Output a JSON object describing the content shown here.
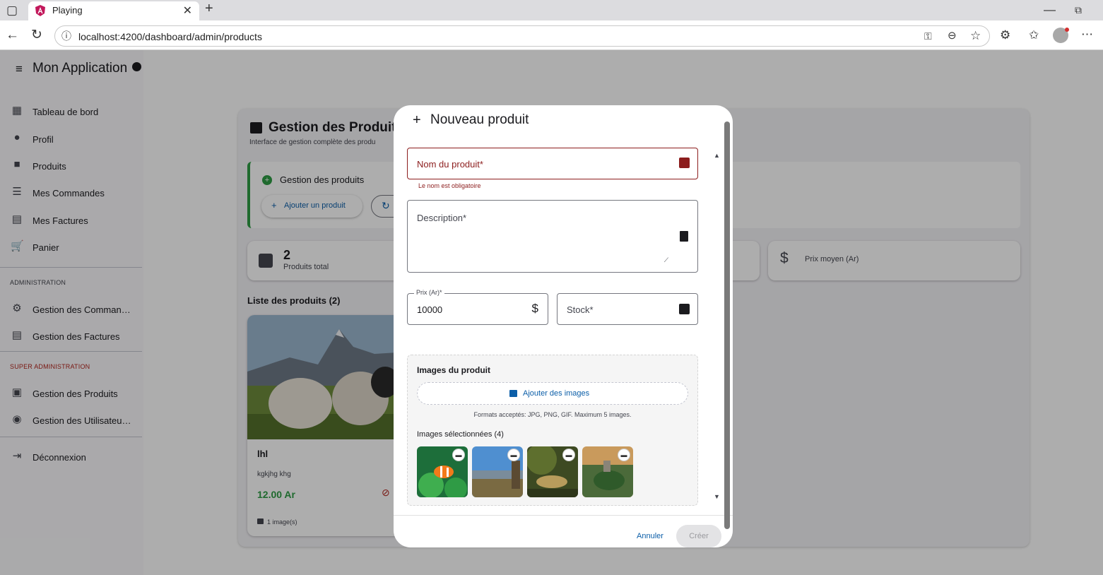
{
  "browser": {
    "tab_title": "Playing",
    "url": "localhost:4200/dashboard/admin/products"
  },
  "app": {
    "title": "Mon Application",
    "nav": [
      {
        "label": "Tableau de bord",
        "icon": "dashboard-icon"
      },
      {
        "label": "Profil",
        "icon": "person-icon"
      },
      {
        "label": "Produits",
        "icon": "shopping-bag-icon"
      },
      {
        "label": "Mes Commandes",
        "icon": "list-icon"
      },
      {
        "label": "Mes Factures",
        "icon": "receipt-icon"
      },
      {
        "label": "Panier",
        "icon": "cart-icon"
      }
    ],
    "admin_section": "ADMINISTRATION",
    "admin_nav": [
      {
        "label": "Gestion des Comman…",
        "icon": "manage-accounts-icon"
      },
      {
        "label": "Gestion des Factures",
        "icon": "receipt-icon"
      }
    ],
    "super_section": "SUPER ADMINISTRATION",
    "super_nav": [
      {
        "label": "Gestion des Produits",
        "icon": "inventory-icon"
      },
      {
        "label": "Gestion des Utilisateu…",
        "icon": "admin-user-icon"
      }
    ],
    "logout": "Déconnexion"
  },
  "page": {
    "title": "Gestion des Produits",
    "subtitle": "Interface de gestion complète des produ",
    "panel_title": "Gestion des produits",
    "add_button": "Ajouter un produit",
    "stat_total_value": "2",
    "stat_total_label": "Produits total",
    "stat_avg_label": "Prix moyen (Ar)",
    "list_title": "Liste des produits (2)",
    "product": {
      "name": "lhl",
      "description": "kgkjhg khg",
      "price": "12.00 Ar",
      "images": "1 image(s)"
    }
  },
  "dialog": {
    "title": "Nouveau produit",
    "name_label": "Nom du produit*",
    "name_error": "Le nom est obligatoire",
    "description_label": "Description*",
    "price_label": "Prix (Ar)*",
    "price_value": "10000",
    "stock_label": "Stock*",
    "images_title": "Images du produit",
    "add_images": "Ajouter des images",
    "formats": "Formats acceptés: JPG, PNG, GIF. Maximum 5 images.",
    "selected": "Images sélectionnées (4)",
    "cancel": "Annuler",
    "create": "Créer"
  },
  "colors": {
    "accent": "#0b5ea8",
    "error": "#8c1d1d",
    "success": "#2e9c45",
    "super_admin": "#b3261e"
  }
}
